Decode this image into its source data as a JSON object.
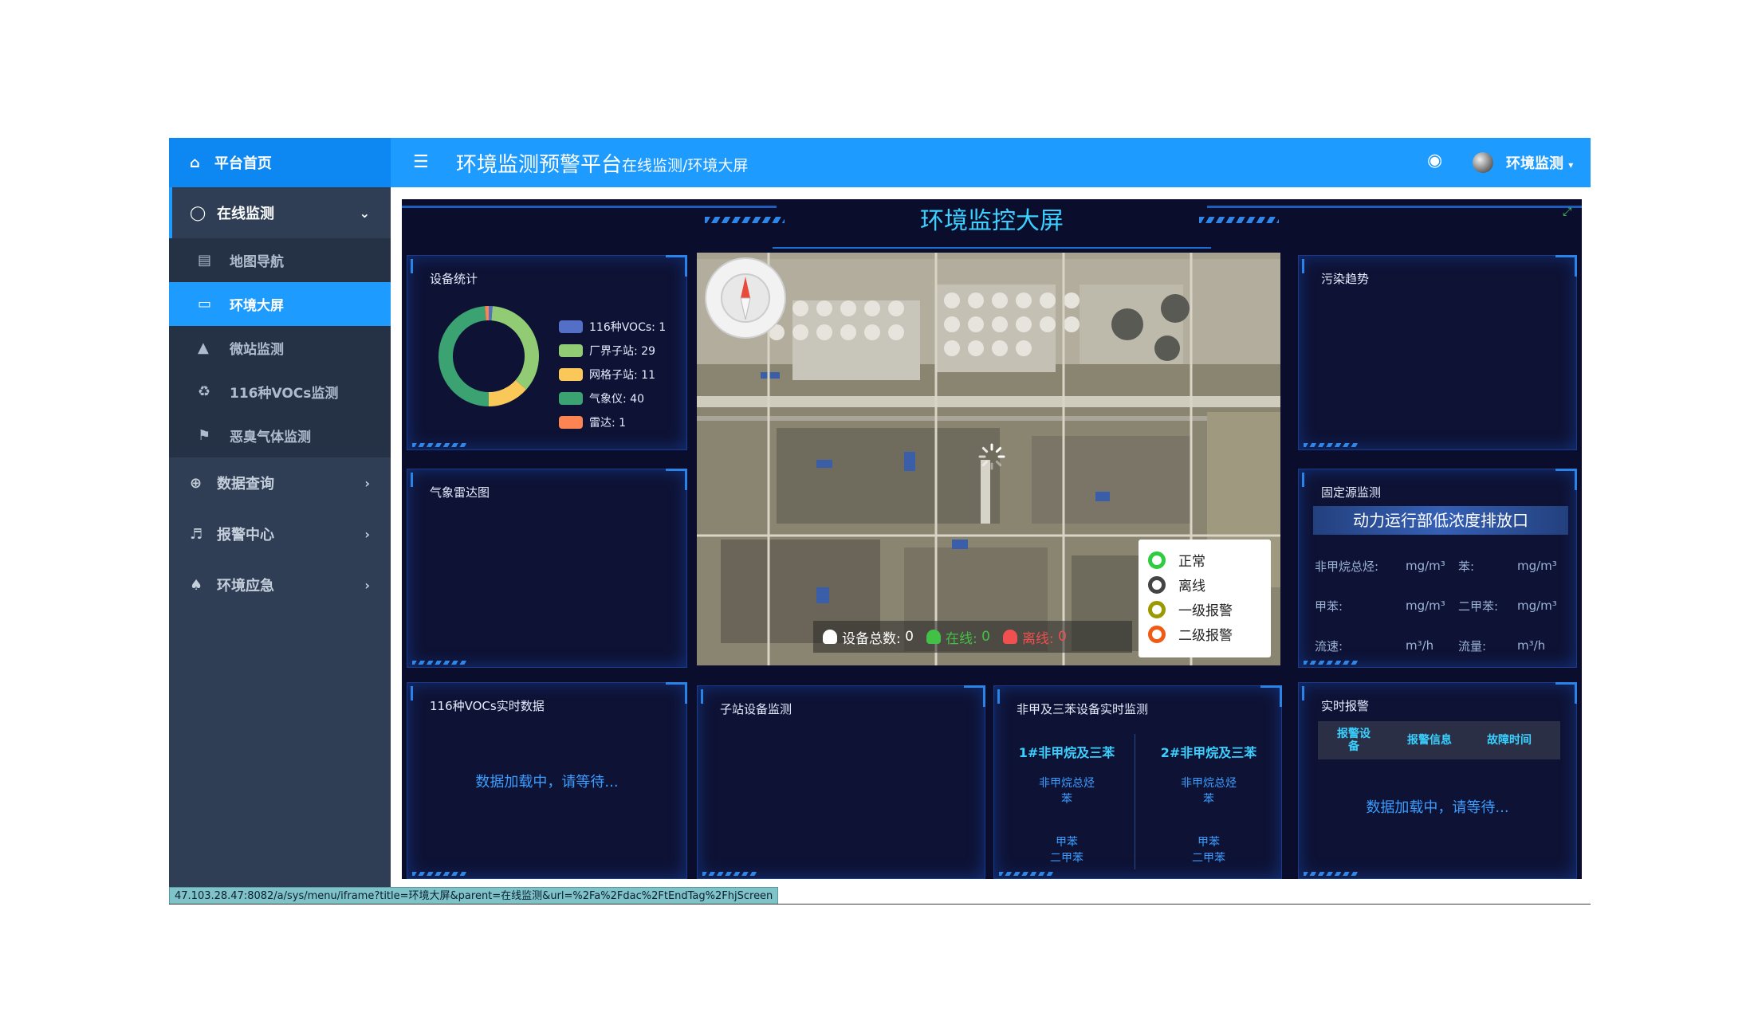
{
  "brand": {
    "label": "平台首页",
    "icon": "home-icon"
  },
  "header": {
    "app_title": "环境监测预警平台",
    "breadcrumb": "在线监测/环境大屏",
    "user_name": "环境监测"
  },
  "sidebar": {
    "items": [
      {
        "label": "在线监测",
        "icon": "headset-icon",
        "expanded": true
      },
      {
        "label": "数据查询",
        "icon": "search-plus-icon"
      },
      {
        "label": "报警中心",
        "icon": "speaker-icon"
      },
      {
        "label": "环境应急",
        "icon": "bell-icon"
      }
    ],
    "subitems": [
      {
        "label": "地图导航",
        "icon": "map-icon"
      },
      {
        "label": "环境大屏",
        "icon": "monitor-icon",
        "active": true
      },
      {
        "label": "微站监测",
        "icon": "building-icon"
      },
      {
        "label": "116种VOCs监测",
        "icon": "recycle-icon"
      },
      {
        "label": "恶臭气体监测",
        "icon": "flag-icon"
      }
    ]
  },
  "screen": {
    "title": "环境监控大屏",
    "device_stats": {
      "title": "设备统计",
      "chart_data": {
        "type": "pie",
        "categories": [
          "116种VOCs",
          "厂界子站",
          "网格子站",
          "气象仪",
          "雷达"
        ],
        "values": [
          1,
          29,
          11,
          40,
          1
        ],
        "colors": [
          "#5470c6",
          "#91cc75",
          "#fac858",
          "#3ba272",
          "#fc8452"
        ],
        "legend_labels": [
          "116种VOCs: 1",
          "厂界子站: 29",
          "网格子站: 11",
          "气象仪: 40",
          "雷达: 1"
        ]
      }
    },
    "radar": {
      "title": "气象雷达图"
    },
    "pollution_trend": {
      "title": "污染趋势"
    },
    "map": {
      "legend": [
        {
          "label": "正常",
          "color": "#2ecc40"
        },
        {
          "label": "离线",
          "color": "#444444"
        },
        {
          "label": "一级报警",
          "color": "#9a9a00"
        },
        {
          "label": "二级报警",
          "color": "#f05a14"
        }
      ],
      "stats": {
        "total_label": "设备总数:",
        "total_value": "0",
        "online_label": "在线:",
        "online_value": "0",
        "offline_label": "离线:",
        "offline_value": "0"
      }
    },
    "fixed_source": {
      "title": "固定源监测",
      "banner": "动力运行部低浓度排放口",
      "rows": [
        [
          "非甲烷总烃:",
          "mg/m³",
          "苯:",
          "mg/m³"
        ],
        [
          "甲苯:",
          "mg/m³",
          "二甲苯:",
          "mg/m³"
        ],
        [
          "流速:",
          "m³/h",
          "流量:",
          "m³/h"
        ]
      ]
    },
    "vocs_realtime": {
      "title": "116种VOCs实时数据",
      "loading": "数据加载中，请等待..."
    },
    "substation": {
      "title": "子站设备监测"
    },
    "benzene": {
      "title": "非甲及三苯设备实时监测",
      "columns": [
        {
          "head": "1#非甲烷及三苯",
          "lines": [
            "非甲烷总烃",
            "苯",
            "",
            "甲苯",
            "二甲苯"
          ]
        },
        {
          "head": "2#非甲烷及三苯",
          "lines": [
            "非甲烷总烃",
            "苯",
            "",
            "甲苯",
            "二甲苯"
          ]
        }
      ]
    },
    "alarm": {
      "title": "实时报警",
      "columns": [
        "报警设备",
        "报警信息",
        "故障时间"
      ],
      "loading": "数据加载中，请等待..."
    }
  },
  "statusbar": {
    "url": "47.103.28.47:8082/a/sys/menu/iframe?title=环境大屏&parent=在线监测&url=%2Fa%2Fdac%2FtEndTag%2FhjScreen"
  }
}
